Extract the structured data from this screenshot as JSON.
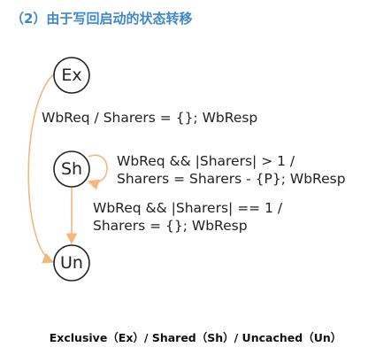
{
  "heading": "（2）由于写回启动的状态转移",
  "states": {
    "ex": "Ex",
    "sh": "Sh",
    "un": "Un"
  },
  "edges": {
    "ex_to_un": [
      "WbReq / Sharers = {}; WbResp"
    ],
    "sh_self": [
      "WbReq && |Sharers| > 1 /",
      "Sharers = Sharers - {P}; WbResp"
    ],
    "sh_to_un": [
      "WbReq && |Sharers| == 1 /",
      "Sharers = {}; WbResp"
    ]
  },
  "caption": "Exclusive（Ex）/ Shared（Sh）/ Uncached（Un）",
  "colors": {
    "heading": "#3f88c8",
    "arrow": "#f4b87e",
    "node_stroke": "#222222",
    "text": "#222222"
  }
}
